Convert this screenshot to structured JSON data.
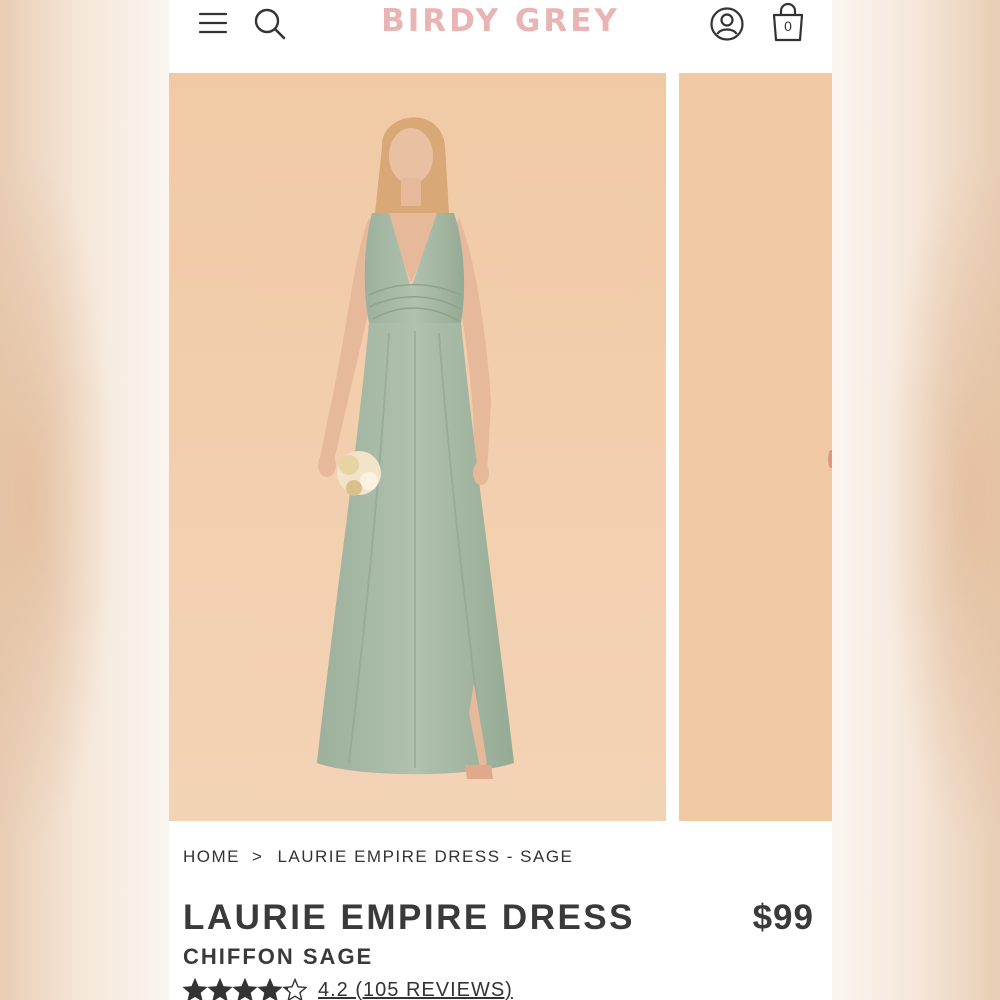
{
  "header": {
    "logo": "BIRDY GREY",
    "cart_count": "0",
    "icons": [
      "menu-icon",
      "search-icon",
      "account-icon",
      "shopping-bag-icon"
    ],
    "logo_color": "#e8b4b4"
  },
  "gallery": {
    "photo_background": "#f0cdad",
    "dress_color": "#a5b9a4"
  },
  "breadcrumb": {
    "home": "HOME",
    "separator": ">",
    "current": "LAURIE EMPIRE DRESS - SAGE"
  },
  "product": {
    "title": "LAURIE EMPIRE DRESS",
    "subtitle": "CHIFFON SAGE",
    "price": "$99",
    "rating_value": 4.2,
    "rating_max": 5,
    "rating_text": "4.2 (105 REVIEWS)"
  }
}
